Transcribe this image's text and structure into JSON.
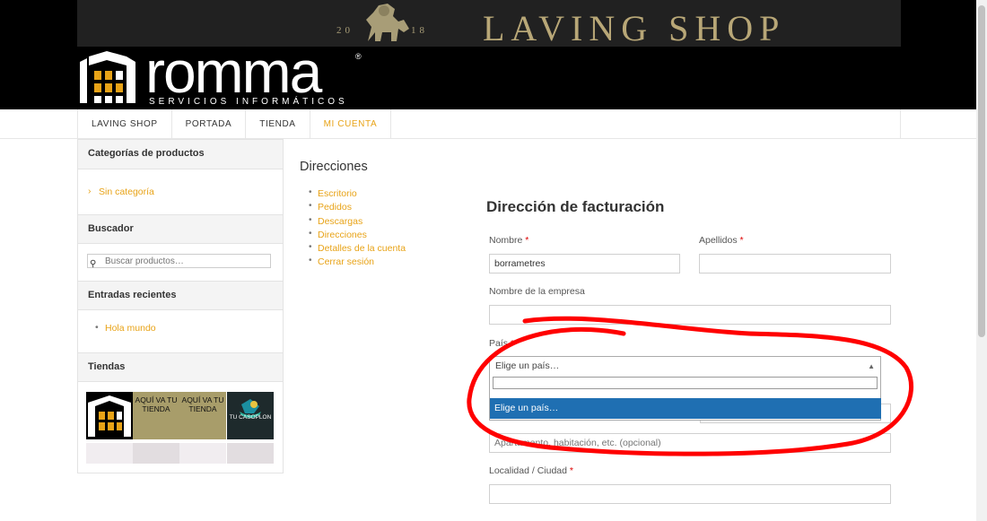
{
  "banner": {
    "year_left": "20",
    "year_right": "18",
    "shop_name": "LAVING SHOP",
    "logo_name": "romma",
    "logo_reg": "®",
    "logo_subtitle": "SERVICIOS INFORMÁTICOS"
  },
  "nav": {
    "items": [
      "LAVING SHOP",
      "PORTADA",
      "TIENDA",
      "MI CUENTA"
    ],
    "active": "MI CUENTA"
  },
  "sidebar": {
    "categories_title": "Categorías de productos",
    "category_link": "Sin categoría",
    "search_title": "Buscador",
    "search_placeholder": "Buscar productos…",
    "recent_title": "Entradas recientes",
    "recent_link": "Hola mundo",
    "stores_title": "Tiendas",
    "tile_text_1": "AQUÍ VA TU TIENDA",
    "tile_text_2": "AQUÍ VA TU TIENDA",
    "tile_text_3": "TU CASOPLON"
  },
  "main": {
    "title": "Direcciones",
    "account_nav": [
      "Escritorio",
      "Pedidos",
      "Descargas",
      "Direcciones",
      "Detalles de la cuenta",
      "Cerrar sesión"
    ]
  },
  "form": {
    "title": "Dirección de facturación",
    "first_name_label": "Nombre",
    "first_name_value": "borrametres",
    "last_name_label": "Apellidos",
    "last_name_value": "",
    "company_label": "Nombre de la empresa",
    "company_value": "",
    "country_label": "País",
    "country_selected": "Elige un país…",
    "country_option": "Elige un país…",
    "address2_placeholder": "Apartamento, habitación, etc. (opcional)",
    "city_label": "Localidad / Ciudad",
    "city_value": "",
    "required_mark": "*"
  },
  "colors": {
    "accent": "#e8a317",
    "highlight": "#1f6fb2",
    "annotation": "#ff0000"
  }
}
